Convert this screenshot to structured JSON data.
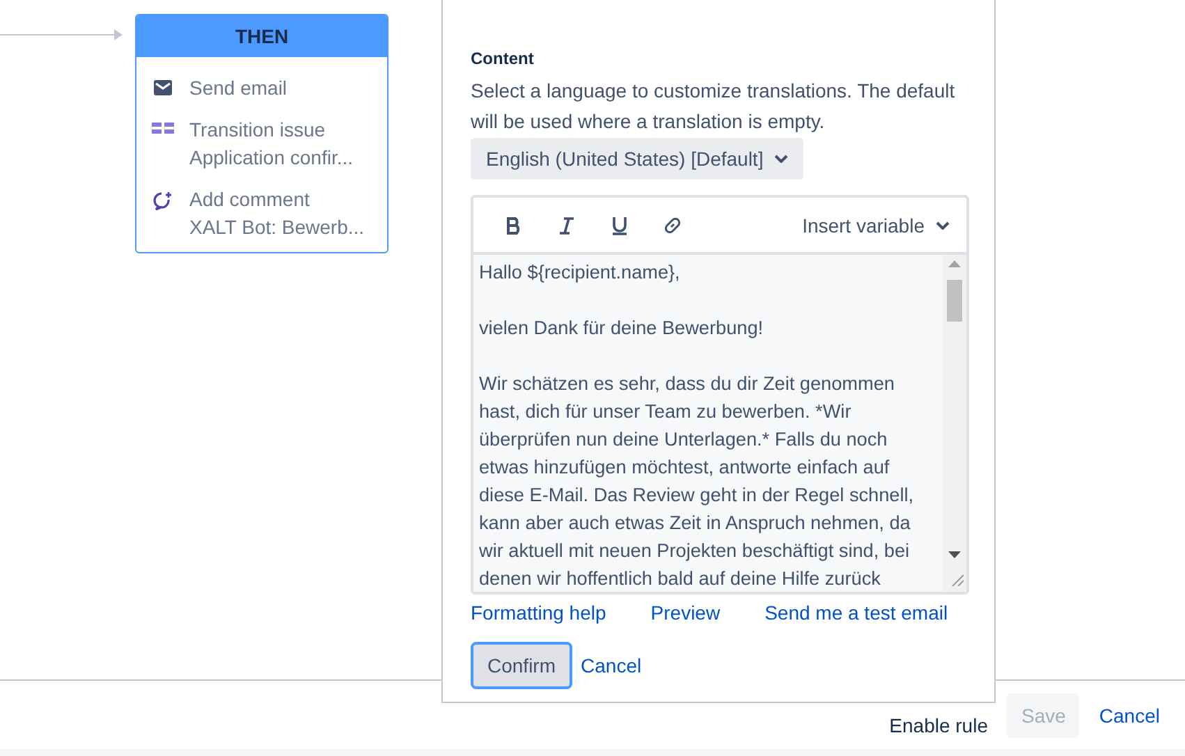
{
  "then_card": {
    "title": "THEN",
    "actions": [
      {
        "kind": "email",
        "title": "Send email"
      },
      {
        "kind": "transition",
        "title": "Transition issue",
        "detail": "Application confir..."
      },
      {
        "kind": "comment",
        "title": "Add comment",
        "detail": "XALT Bot: Bewerb..."
      }
    ]
  },
  "panel": {
    "section_label": "Content",
    "description": "Select a language to customize translations. The default will be used where a translation is empty.",
    "language": "English (United States) [Default]",
    "toolbar": {
      "format_buttons": [
        {
          "kind": "bold"
        },
        {
          "kind": "italic"
        },
        {
          "kind": "underline"
        },
        {
          "kind": "link"
        }
      ],
      "insert_variable": "Insert variable"
    },
    "body": "Hallo ${recipient.name},\n\nvielen Dank für deine Bewerbung!\n\nWir schätzen es sehr, dass du dir Zeit genommen hast, dich für unser Team zu bewerben. *Wir überprüfen nun deine Unterlagen.* Falls du noch etwas hinzufügen möchtest, antworte einfach auf diese E-Mail. Das Review geht in der Regel schnell, kann aber auch etwas Zeit in Anspruch nehmen, da wir aktuell mit neuen Projekten beschäftigt sind, bei denen wir hoffentlich bald auf deine Hilfe zurück",
    "links": [
      "Formatting help",
      "Preview",
      "Send me a test email"
    ],
    "confirm": "Confirm",
    "cancel": "Cancel"
  },
  "footer": {
    "enable_rule": "Enable rule",
    "save": {
      "label": "Save",
      "disabled": true
    },
    "cancel": "Cancel"
  }
}
